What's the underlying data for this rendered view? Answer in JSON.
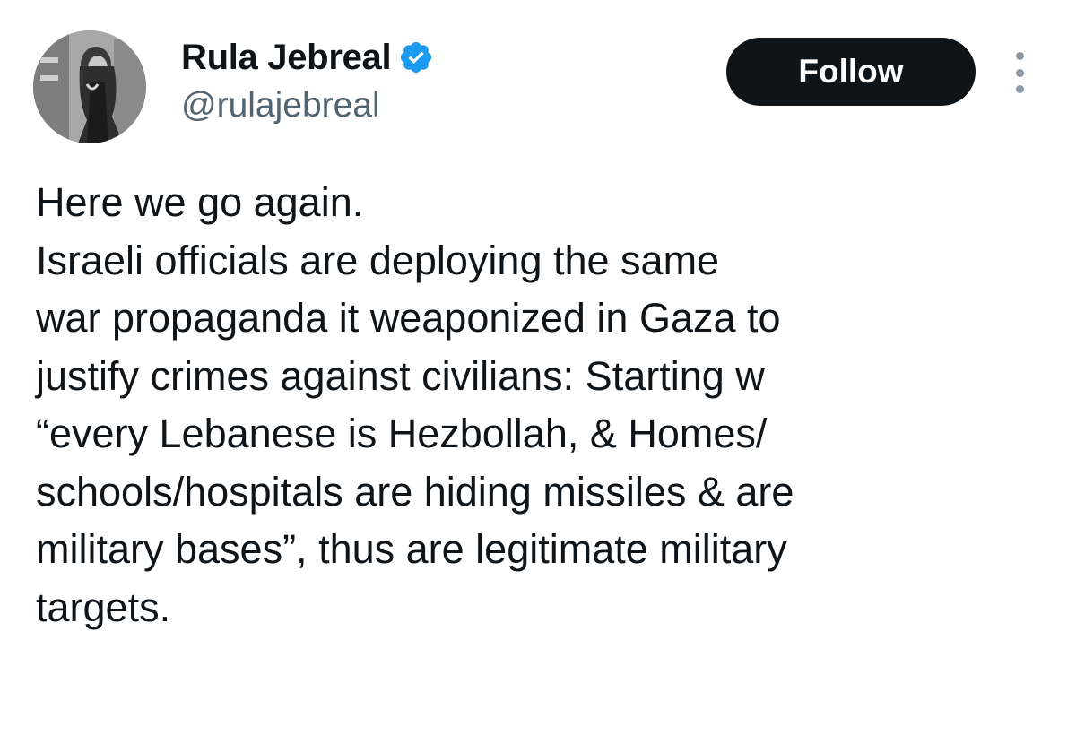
{
  "author": {
    "display_name": "Rula Jebreal",
    "handle": "@rulajebreal",
    "verified": true,
    "verified_color": "#1d9bf0",
    "avatar_icon": "profile-photo"
  },
  "actions": {
    "follow_label": "Follow",
    "more_icon": "more-vertical-icon"
  },
  "tweet": {
    "lines": [
      "Here we go again.",
      "Israeli officials are deploying the same",
      "war propaganda it weaponized in Gaza to",
      "justify crimes against civilians: Starting w",
      "“every Lebanese is Hezbollah, & Homes/",
      "schools/hospitals are hiding missiles & are",
      "military bases”, thus are legitimate military",
      "targets."
    ]
  },
  "colors": {
    "text": "#0f1419",
    "secondary_text": "#536471",
    "button_bg": "#0f1419",
    "button_text": "#ffffff"
  }
}
